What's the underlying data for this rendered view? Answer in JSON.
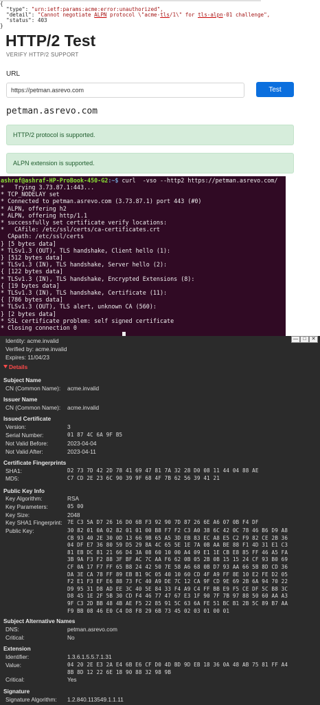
{
  "json_error": {
    "brace_open": "{",
    "type_key": "\"type\": ",
    "type_val": "\"urn:ietf:params:acme:error:unauthorized\",",
    "detail_key": "\"detail\": ",
    "detail_val_1": "\"Cannot negotiate ",
    "detail_alpn": "ALPN",
    "detail_val_2": " protocol \\\"acme-",
    "detail_tls": "tls",
    "detail_val_3": "/1\\\" for ",
    "detail_tlsalpn": "tls-alpn",
    "detail_val_4": "-01 challenge\",",
    "status_key": "\"status\": ",
    "status_val": "403",
    "brace_close": "}"
  },
  "page": {
    "title": "HTTP/2 Test",
    "subtitle": "VERIFY HTTP/2 SUPPORT",
    "url_label": "URL",
    "url_value": "https://petman.asrevo.com",
    "test_button": "Test",
    "domain": "petman.asrevo.com",
    "alert_h2": "HTTP/2 protocol is supported.",
    "alert_alpn": "ALPN extension is supported."
  },
  "terminal": {
    "prompt_user": "ashraf@ashraf-HP-ProBook-450-G2",
    "prompt_path": ":~$",
    "command": " curl  -vso --http2 https://petman.asrevo.com/",
    "lines": [
      "*   Trying 3.73.87.1:443...",
      "* TCP_NODELAY set",
      "* Connected to petman.asrevo.com (3.73.87.1) port 443 (#0)",
      "* ALPN, offering h2",
      "* ALPN, offering http/1.1",
      "* successfully set certificate verify locations:",
      "*   CAfile: /etc/ssl/certs/ca-certificates.crt",
      "  CApath: /etc/ssl/certs",
      "} [5 bytes data]",
      "* TLSv1.3 (OUT), TLS handshake, Client hello (1):",
      "} [512 bytes data]",
      "* TLSv1.3 (IN), TLS handshake, Server hello (2):",
      "{ [122 bytes data]",
      "* TLSv1.3 (IN), TLS handshake, Encrypted Extensions (8):",
      "{ [19 bytes data]",
      "* TLSv1.3 (IN), TLS handshake, Certificate (11):",
      "{ [786 bytes data]",
      "* TLSv1.3 (OUT), TLS alert, unknown CA (560):",
      "} [2 bytes data]",
      "* SSL certificate problem: self signed certificate",
      "* Closing connection 0"
    ]
  },
  "cert": {
    "window_buttons": [
      "—",
      "□",
      "✕"
    ],
    "identity": "Identity: acme.invalid",
    "verified_by": "Verified by: acme.invalid",
    "expires": "Expires: 11/04/23",
    "details": "Details",
    "subject_name": "Subject Name",
    "subject_cn_label": "CN (Common Name):",
    "subject_cn": "acme.invalid",
    "issuer_name": "Issuer Name",
    "issuer_cn_label": "CN (Common Name):",
    "issuer_cn": "acme.invalid",
    "issued_cert": "Issued Certificate",
    "version_label": "Version:",
    "version": "3",
    "serial_label": "Serial Number:",
    "serial": "01 87 4C 6A 9F B5",
    "not_before_label": "Not Valid Before:",
    "not_before": "2023-04-04",
    "not_after_label": "Not Valid After:",
    "not_after": "2023-04-11",
    "fingerprints": "Certificate Fingerprints",
    "sha1_label": "SHA1:",
    "sha1": "D2 73 7D 42 2D 78 41 69 47 81 7A 32 28 D0 08 11 44 04 88 AE",
    "md5_label": "MD5:",
    "md5": "C7 CD 2E 23 6C 90 39 9F 68 4F 7B 62 56 39 41 21",
    "pubkey_info": "Public Key Info",
    "key_alg_label": "Key Algorithm:",
    "key_alg": "RSA",
    "key_params_label": "Key Parameters:",
    "key_params": "05 00",
    "key_size_label": "Key Size:",
    "key_size": "2048",
    "key_sha1_label": "Key SHA1 Fingerprint:",
    "key_sha1": "7E C3 5A D7 26 16 D0 6B F3 92 90 7D 87 26 6E A6 07 0B F4 DF",
    "pubkey_label": "Public Key:",
    "pubkey_lines": [
      "30 82 01 0A 02 82 01 01 00 B8 F7 F2 C3 A0 38 6C 42 0C 78 46 B6 D9 A8",
      "CB 93 40 2E 30 0D 13 66 9B 65 A5 3D EB 83 EC A8 E5 C2 F9 82 CE 2B 36",
      "04 DF E7 36 80 59 D5 29 8A 4C 65 5E 1E 7A 0B AA BE 88 F1 4D 31 E1 C3",
      "81 EB DC 81 21 66 D4 3A 08 60 10 00 A4 09 E1 1E CB E8 85 FF 46 A5 FA",
      "3B 9A F3 F2 88 3F BF AC 7C AA F6 62 0B 05 2B 0B 15 15 24 CF 93 B0 69",
      "CF 0A 17 F7 FF 65 B8 24 42 50 7E 58 A6 68 0B D7 93 AA 66 5B 8D CD 36",
      "DA 3E CA 78 FF 89 EB B1 9C 05 40 10 60 CD 4F A9 FF 8E 10 E2 FE D2 05",
      "F2 E1 F3 EF E6 88 73 FC 40 A9 DE 7C 12 CA 9F CD 9E 69 2B 6A 94 70 22",
      "D9 95 31 D8 AD EE 3C 40 5E 84 33 F4 A9 C4 FF BB E9 F5 CE DF 5C B8 3C",
      "D8 45 1E 2F 5B 30 CD F4 46 77 47 67 E3 1F 90 7F 7B 97 88 50 60 AA A3",
      "9F C3 2D BB 48 4B AE F5 22 85 91 5C 63 6A FE 51 BC B1 2B 5C 89 B7 AA",
      "F9 BB 08 46 E0 C4 D8 F8 29 6B 73 45 02 03 01 00 01"
    ],
    "san": "Subject Alternative Names",
    "dns_label": "DNS:",
    "dns": "petman.asrevo.com",
    "san_critical_label": "Critical:",
    "san_critical": "No",
    "extension": "Extension",
    "identifier_label": "Identifier:",
    "identifier": "1.3.6.1.5.5.7.1.31",
    "ext_value_label": "Value:",
    "ext_value_lines": [
      "04 20 2E E3 2A E4 6B E6 CF D0 4D BD 9D EB 18 36 0A 48 AB 75 81 FF A4",
      "8B 8D 12 22 6E 18 90 88 32 98 9B"
    ],
    "ext_critical_label": "Critical:",
    "ext_critical": "Yes",
    "signature": "Signature",
    "sig_alg_label": "Signature Algorithm:",
    "sig_alg": "1.2.840.113549.1.1.11"
  }
}
